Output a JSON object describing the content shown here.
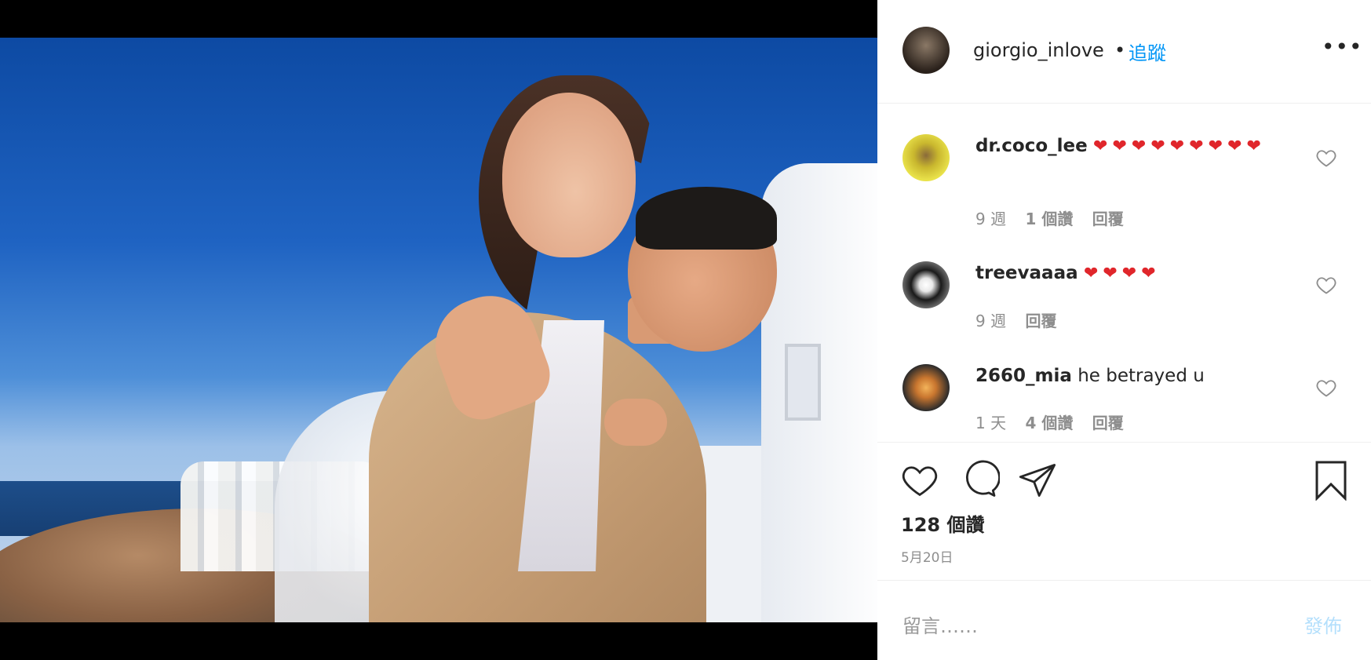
{
  "post": {
    "username": "giorgio_inlove",
    "separator": "•",
    "follow_label": "追蹤",
    "more_label": "•••"
  },
  "comments": [
    {
      "user": "dr.coco_lee",
      "text": "❤❤❤❤❤❤❤❤❤",
      "time": "9 週",
      "likes": "1 個讚",
      "reply": "回覆"
    },
    {
      "user": "treevaaaa",
      "text": "❤❤❤❤",
      "time": "9 週",
      "likes": "",
      "reply": "回覆"
    },
    {
      "user": "2660_mia",
      "text": "he betrayed u",
      "time": "1 天",
      "likes": "4 個讚",
      "reply": "回覆"
    }
  ],
  "actions": {
    "icons": [
      "heart-icon",
      "comment-icon",
      "share-icon",
      "bookmark-icon"
    ],
    "like_count": "128 個讚",
    "date": "5月20日"
  },
  "composer": {
    "placeholder": "留言……",
    "post_label": "發佈"
  },
  "colors": {
    "link": "#0095f6",
    "post_disabled": "#b3dffc",
    "heart": "#e0262b"
  }
}
